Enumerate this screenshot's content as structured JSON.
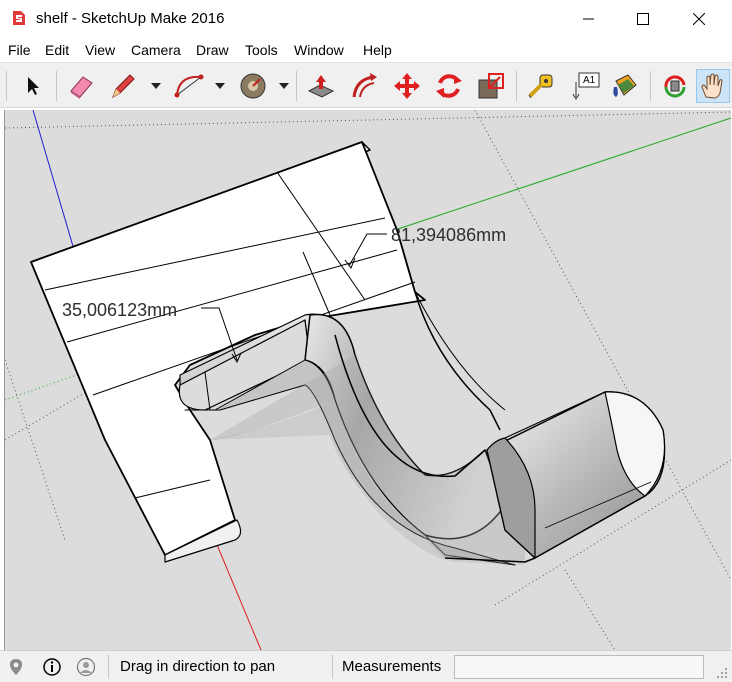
{
  "window": {
    "title": "shelf - SketchUp Make 2016",
    "controls": [
      "minimize",
      "maximize",
      "close"
    ]
  },
  "menu": {
    "items": [
      "File",
      "Edit",
      "View",
      "Camera",
      "Draw",
      "Tools",
      "Window",
      "Help"
    ]
  },
  "toolbar": {
    "tools": [
      {
        "name": "select-icon"
      },
      {
        "name": "eraser-icon"
      },
      {
        "name": "pencil-icon"
      },
      {
        "name": "arc-icon"
      },
      {
        "name": "shapes-icon"
      },
      {
        "name": "push-pull-icon"
      },
      {
        "name": "offset-icon"
      },
      {
        "name": "move-icon"
      },
      {
        "name": "rotate-icon"
      },
      {
        "name": "scale-icon"
      },
      {
        "name": "tape-measure-icon"
      },
      {
        "name": "text-icon"
      },
      {
        "name": "paint-bucket-icon"
      },
      {
        "name": "orbit-icon"
      },
      {
        "name": "pan-icon"
      }
    ],
    "text_tool_label": "A1",
    "active_tool": "pan-icon"
  },
  "viewport": {
    "dimensions": [
      {
        "label": "81,394086mm"
      },
      {
        "label": "35,006123mm"
      }
    ],
    "axis_colors": {
      "red": "#e02020",
      "green": "#1fa81f",
      "blue": "#2020d0"
    }
  },
  "statusbar": {
    "hint": "Drag in direction to pan",
    "measurements_label": "Measurements",
    "measurements_value": ""
  }
}
